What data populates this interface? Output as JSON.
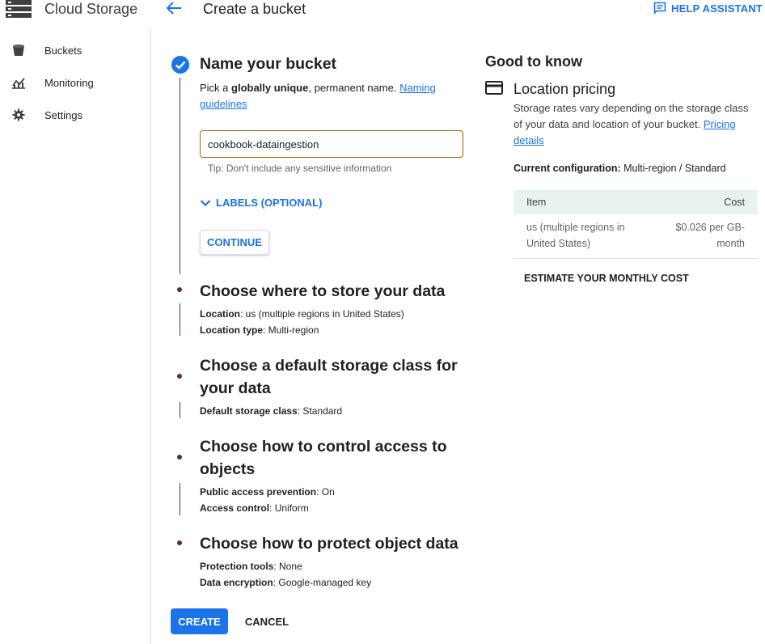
{
  "header": {
    "app_title": "Cloud Storage",
    "page_title": "Create a bucket",
    "help_label": "HELP ASSISTANT"
  },
  "sidebar": {
    "items": [
      {
        "label": "Buckets",
        "icon": "bucket-icon"
      },
      {
        "label": "Monitoring",
        "icon": "chart-icon"
      },
      {
        "label": "Settings",
        "icon": "gear-icon"
      }
    ]
  },
  "steps": {
    "name": {
      "title": "Name your bucket",
      "desc_pre": "Pick a ",
      "desc_bold": "globally unique",
      "desc_post": ", permanent name. ",
      "desc_link": "Naming guidelines",
      "input_value": "cookbook-dataingestion",
      "tip": "Tip: Don't include any sensitive information",
      "labels_toggle": "LABELS (OPTIONAL)",
      "continue_label": "CONTINUE"
    },
    "location": {
      "title": "Choose where to store your data",
      "line1_key": "Location",
      "line1_val": ": us (multiple regions in United States)",
      "line2_key": "Location type",
      "line2_val": ": Multi-region"
    },
    "storage_class": {
      "title_line1": "Choose a default storage class for",
      "title_line2": "your data",
      "line1_key": "Default storage class",
      "line1_val": ": Standard"
    },
    "access": {
      "title_line1": "Choose how to control access to",
      "title_line2": "objects",
      "line1_key": "Public access prevention",
      "line1_val": ": On",
      "line2_key": "Access control",
      "line2_val": ": Uniform"
    },
    "protect": {
      "title": "Choose how to protect object data",
      "line1_key": "Protection tools",
      "line1_val": ": None",
      "line2_key": "Data encryption",
      "line2_val": ": Google-managed key"
    }
  },
  "actions": {
    "create_label": "CREATE",
    "cancel_label": "CANCEL"
  },
  "good_to_know": {
    "title": "Good to know",
    "pricing_title": "Location pricing",
    "pricing_text": "Storage rates vary depending on the storage class of your data and location of your bucket. ",
    "pricing_link": "Pricing details",
    "current_key": "Current configuration:",
    "current_val": " Multi-region / Standard",
    "table": {
      "col_item": "Item",
      "col_cost": "Cost",
      "rows": [
        {
          "item_line1": "us (multiple regions in",
          "item_line2": "United States)",
          "cost_line1": "$0.026 per GB-",
          "cost_line2": "month"
        }
      ]
    },
    "estimate_label": "ESTIMATE YOUR MONTHLY COST"
  },
  "colors": {
    "accent": "#1a73e8",
    "input_border": "#b06000",
    "stepper_line": "#5f2f2f",
    "table_header_bg": "#e8f3ee"
  }
}
